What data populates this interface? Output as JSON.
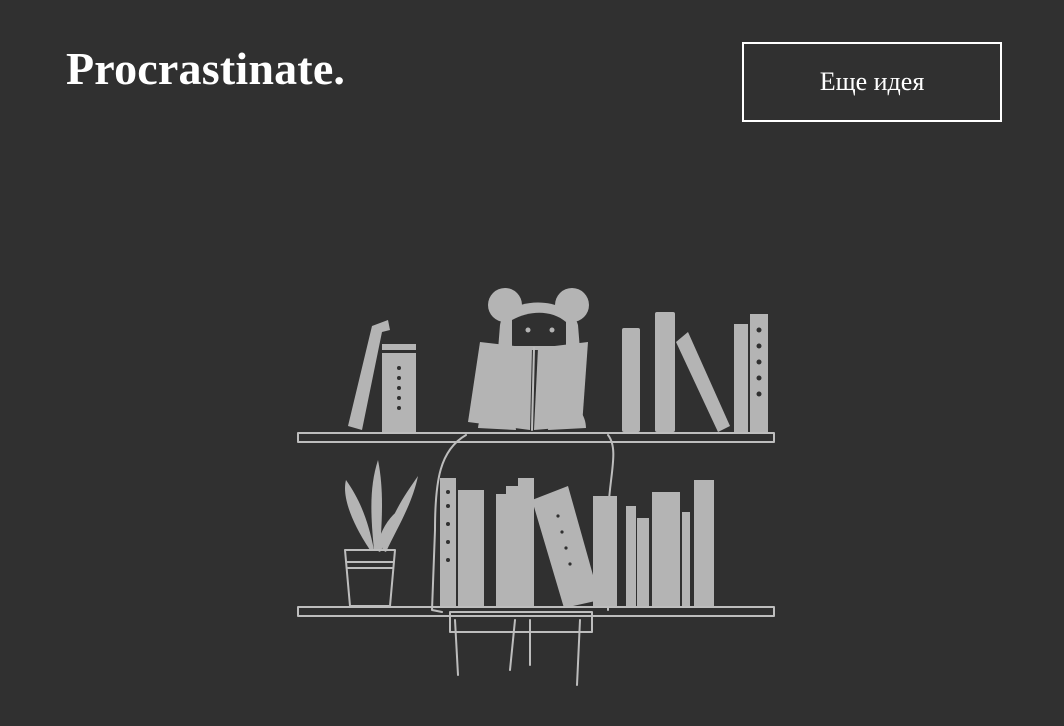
{
  "header": {
    "logo_text": "Procrastinate.",
    "idea_button_label": "Еще идея"
  },
  "illustration": {
    "subject": "girl-reading-behind-bookshelf",
    "color": "#b4b4b4",
    "background": "#303030"
  }
}
